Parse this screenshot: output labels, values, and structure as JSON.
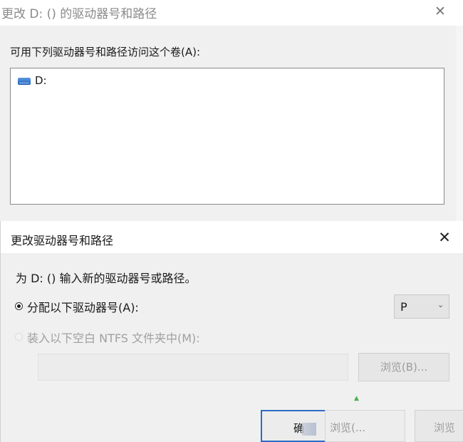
{
  "back_dialog": {
    "title": "更改 D: () 的驱动器号和路径",
    "close_glyph": "✕",
    "prompt": "可用下列驱动器号和路径访问这个卷(A):",
    "drives": [
      {
        "label": "D:",
        "icon": "drive-icon"
      }
    ]
  },
  "front_dialog": {
    "title": "更改驱动器号和路径",
    "close_glyph": "✕",
    "instruction": "为 D: () 输入新的驱动器号或路径。",
    "assign_option": {
      "label": "分配以下驱动器号(A):",
      "selected": true
    },
    "drive_letter": {
      "value": "P",
      "chevron": "⌄"
    },
    "mount_option": {
      "label": "装入以下空白 NTFS 文件夹中(M):",
      "selected": false,
      "enabled": false
    },
    "path_field": {
      "value": ""
    },
    "browse_button": "浏览(B)...",
    "ok_button": "确",
    "cancel_button": "浏览(...",
    "ghost_button": "浏览"
  },
  "colors": {
    "accent": "#2b6cc4",
    "dialog_bg": "#f0f0f0",
    "disabled_text": "#a0a0a0"
  }
}
